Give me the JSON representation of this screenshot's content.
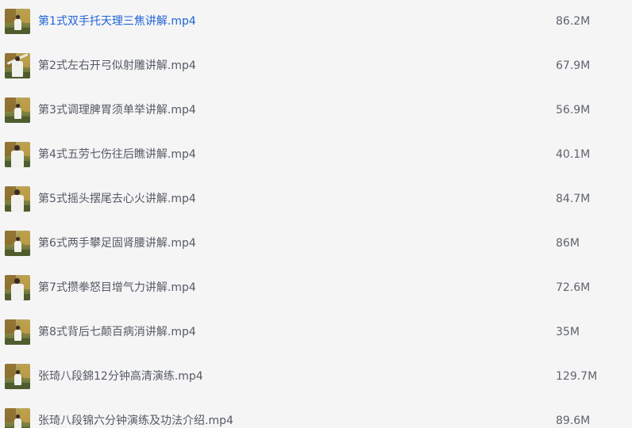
{
  "files": [
    {
      "name": "第1式双手托天理三焦讲解.mp4",
      "size": "86.2M",
      "thumb_icon": "video-thumbnail-icon",
      "active": true
    },
    {
      "name": "第2式左右开弓似射雕讲解.mp4",
      "size": "67.9M",
      "thumb_icon": "video-thumbnail-icon",
      "active": false
    },
    {
      "name": "第3式调理脾胃须单举讲解.mp4",
      "size": "56.9M",
      "thumb_icon": "video-thumbnail-icon",
      "active": false
    },
    {
      "name": "第4式五劳七伤往后瞧讲解.mp4",
      "size": "40.1M",
      "thumb_icon": "video-thumbnail-icon",
      "active": false
    },
    {
      "name": "第5式摇头摆尾去心火讲解.mp4",
      "size": "84.7M",
      "thumb_icon": "video-thumbnail-icon",
      "active": false
    },
    {
      "name": "第6式两手攀足固肾腰讲解.mp4",
      "size": "86M",
      "thumb_icon": "video-thumbnail-icon",
      "active": false
    },
    {
      "name": "第7式攒拳怒目增气力讲解.mp4",
      "size": "72.6M",
      "thumb_icon": "video-thumbnail-icon",
      "active": false
    },
    {
      "name": "第8式背后七颠百病消讲解.mp4",
      "size": "35M",
      "thumb_icon": "video-thumbnail-icon",
      "active": false
    },
    {
      "name": "张琦八段錦12分钟高清演练.mp4",
      "size": "129.7M",
      "thumb_icon": "video-thumbnail-icon",
      "active": false
    },
    {
      "name": "张琦八段锦六分钟演练及功法介绍.mp4",
      "size": "89.6M",
      "thumb_icon": "video-thumbnail-icon",
      "active": false
    }
  ],
  "colors": {
    "background": "#f5f5f6",
    "active_link": "#1f63d6",
    "text": "#555a63"
  }
}
